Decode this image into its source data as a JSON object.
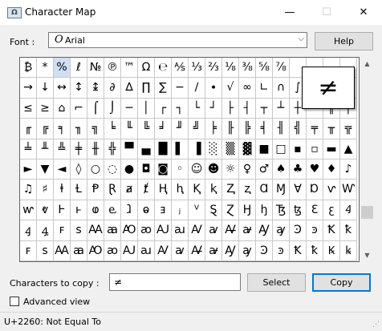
{
  "window": {
    "title": "Character Map",
    "icon_name": "character-map-icon",
    "minimize_symbol": "—",
    "maximize_symbol": "☐",
    "close_symbol": "✕"
  },
  "font": {
    "label": "Font :",
    "selected": "Arial",
    "glyph": "O",
    "options_arrow": "⌵"
  },
  "buttons": {
    "help": "Help",
    "select": "Select",
    "copy": "Copy"
  },
  "grid": {
    "columns": 20,
    "selected_index": 2,
    "chars": [
      "₿",
      "*",
      "%",
      "ℓ",
      "№",
      "℗",
      "™",
      "Ω",
      "℮",
      "⅍",
      "⅓",
      "⅔",
      "⅛",
      "⅜",
      "⅝",
      "⅞",
      "",
      "",
      "",
      "",
      "→",
      "↓",
      "↔",
      "↕",
      "↨",
      "∂",
      "∆",
      "∏",
      "∑",
      "−",
      "∕",
      "∙",
      "√",
      "∞",
      "∟",
      "∩",
      "∫",
      "≈",
      "≠",
      "≡",
      "≤",
      "≥",
      "⌂",
      "⌐",
      "⌠",
      "⌡",
      "─",
      "│",
      "┌",
      "┐",
      "└",
      "┘",
      "├",
      "┤",
      "┬",
      "┴",
      "┼",
      "═",
      "║",
      "╒",
      "╓",
      "╔",
      "╕",
      "╖",
      "╗",
      "╘",
      "╙",
      "╚",
      "╛",
      "╜",
      "╝",
      "╞",
      "╟",
      "╠",
      "╡",
      "╢",
      "╣",
      "╤",
      "╥",
      "╦",
      "╧",
      "╨",
      "╩",
      "╪",
      "╫",
      "╬",
      "▀",
      "▄",
      "█",
      "▌",
      "▐",
      "░",
      "▒",
      "▓",
      "■",
      "□",
      "▪",
      "▫",
      "▬",
      "▲",
      "►",
      "▼",
      "◄",
      "◊",
      "○",
      "◌",
      "●",
      "◘",
      "◙",
      "◦",
      "☺",
      "☻",
      "☼",
      "♀",
      "♂",
      "♠",
      "♣",
      "♥",
      "♦",
      "♪",
      "♫",
      "♯",
      "ⱡ",
      "Ɫ",
      "Ᵽ",
      "Ɽ",
      "ⱥ",
      "ⱦ",
      "Ⱨ",
      "ⱨ",
      "Ⱪ",
      "ⱪ",
      "Ⱬ",
      "ⱬ",
      "Ɑ",
      "Ɱ",
      "Ɐ",
      "Ɒ",
      "ⱱ",
      "Ⱳ",
      "ⱳ",
      "ⱴ",
      "Ⱶ",
      "ⱶ",
      "ⱷ",
      "ⱸ",
      "ⱹ",
      "ⱺ",
      "ⱻ",
      "ⱼ",
      "ⱽ",
      "Ȿ",
      "Ɀ",
      "Ꜧ",
      "ꜧ",
      "Ꜩ",
      "ꜩ",
      "Ꜫ",
      "ꜫ",
      "Ꜭ",
      "ꜭ",
      "ꜯ",
      "ꜰ",
      "ꜱ",
      "Ꜳ",
      "ꜳ",
      "Ꜵ",
      "ꜵ",
      "Ꜷ",
      "ꜷ",
      "Ꜹ",
      "ꜹ",
      "Ꜻ",
      "ꜻ",
      "Ꜽ",
      "ꜽ",
      "Ꜿ",
      "ꜿ",
      "Ꝁ",
      "ꝁ",
      "ꜰ",
      "ꜱ",
      "Ꜳ",
      "ꜳ",
      "Ꜵ",
      "ꜵ",
      "Ꜷ",
      "ꜷ",
      "Ꜹ",
      "ꜹ",
      "Ꜻ",
      "ꜻ",
      "Ꜽ",
      "ꜽ",
      "Ꜿ",
      "ꜿ",
      "Ꝁ",
      "ꝁ",
      "Ꝃ",
      "ꝃ"
    ]
  },
  "zoom": {
    "char": "≠"
  },
  "copy_field": {
    "label": "Characters to copy :",
    "value": "≠"
  },
  "advanced": {
    "label": "Advanced view",
    "checked": false
  },
  "status": {
    "text": "U+2260: Not Equal To"
  }
}
